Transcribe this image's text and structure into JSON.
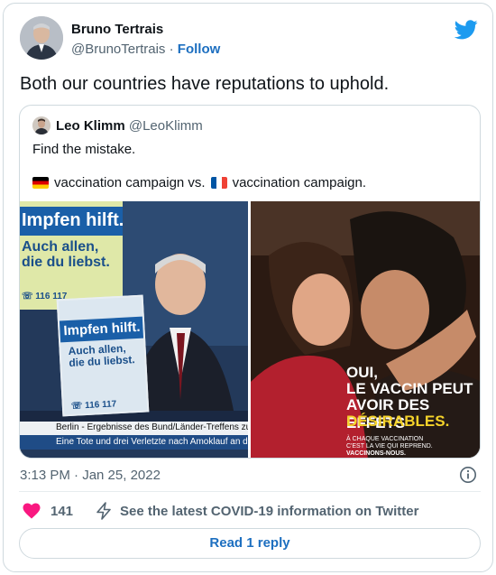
{
  "author": {
    "name": "Bruno Tertrais",
    "handle": "@BrunoTertrais",
    "separator": " · ",
    "follow_label": "Follow"
  },
  "tweet": {
    "text": "Both our countries have reputations to uphold."
  },
  "quoted": {
    "name": "Leo Klimm",
    "handle": "@LeoKlimm",
    "line1": "Find the mistake.",
    "line2_part1": "vaccination campaign vs.",
    "line2_part2": "vaccination campaign.",
    "left_image": {
      "poster_headline": "Impfen hilft.",
      "poster_subline_1": "Auch allen,",
      "poster_subline_2": "die du liebst.",
      "poster_phone": "116 117",
      "ticker_top": "Berlin - Ergebnisse des Bund/Länder-Treffens zur C",
      "ticker_bottom": "Eine Tote und drei Verletzte nach Amoklauf an der Univ"
    },
    "right_image": {
      "line1": "OUI,",
      "line2": "LE VACCIN PEUT",
      "line3": "AVOIR DES EFFETS",
      "line4": "DÉSIRABLES.",
      "small1": "À CHAQUE VACCINATION",
      "small2": "C'EST LA VIE QUI REPREND.",
      "small3": "VACCINONS-NOUS."
    }
  },
  "meta": {
    "timestamp": "3:13 PM · Jan 25, 2022"
  },
  "actions": {
    "likes": "141",
    "covid_info": "See the latest COVID-19 information on Twitter",
    "reply_button": "Read 1 reply"
  },
  "colors": {
    "accent": "#1d6fc0",
    "twitter_blue": "#1d9bf0",
    "heart": "#f91880",
    "secondary_text": "#536471"
  },
  "icons": [
    "twitter-bird-icon",
    "info-icon",
    "heart-icon",
    "bolt-icon"
  ]
}
